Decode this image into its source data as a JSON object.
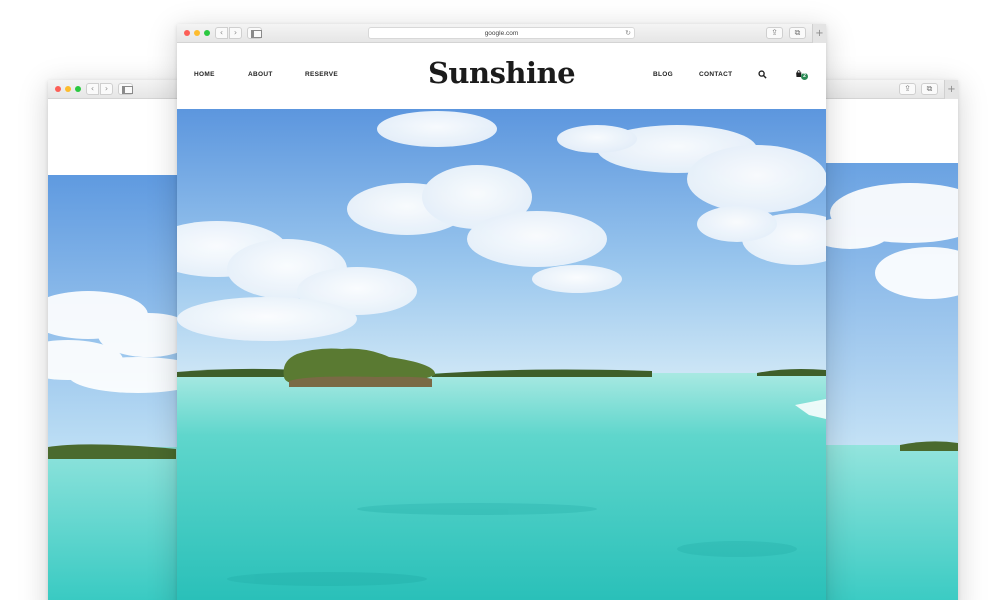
{
  "browser": {
    "url": "google.com",
    "back_glyph": "‹",
    "forward_glyph": "›",
    "reload_glyph": "↻",
    "share_glyph": "⇪",
    "tabs_glyph": "⧉",
    "new_tab_glyph": "+"
  },
  "site": {
    "brand": "Sunshine",
    "nav_left": [
      "HOME",
      "ABOUT",
      "RESERVE"
    ],
    "nav_right": [
      "BLOG",
      "CONTACT"
    ],
    "cart_count": "2"
  },
  "icons": {
    "search": "search-icon",
    "cart": "shopping-bag-icon",
    "close": "close-dot",
    "minimize": "minimize-dot",
    "zoom": "zoom-dot",
    "sidebar": "sidebar-icon",
    "share": "share-icon",
    "tabs": "tabs-icon"
  },
  "colors": {
    "sky_top": "#5f9ae0",
    "sky_horizon": "#bfe0f5",
    "sea_near": "#2ec7bf",
    "sea_far": "#8fe3dc",
    "island": "#4a6a2e",
    "traffic_red": "#fc5f57",
    "traffic_yellow": "#fdbc2e",
    "traffic_green": "#2ac840"
  }
}
